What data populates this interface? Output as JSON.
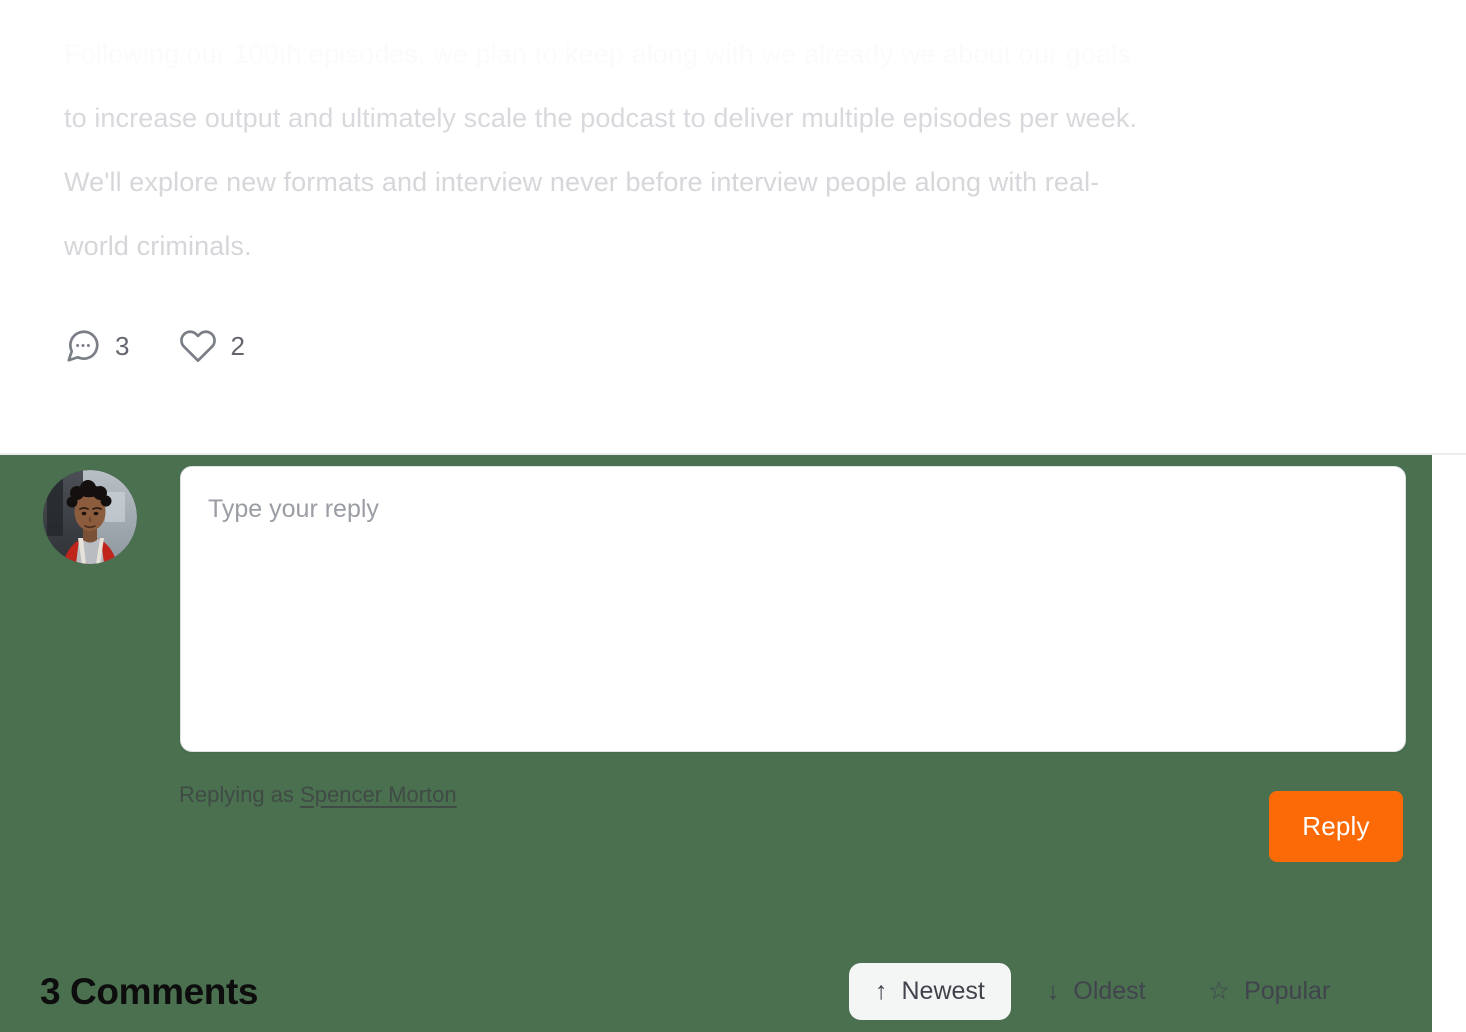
{
  "post": {
    "paragraph_lines": [
      "Following our 100th episodes, we plan to keep along with we already we about our goals",
      "to increase output and ultimately scale the podcast to deliver multiple episodes per week.",
      "We'll explore new formats and interview never before interview people along with real-",
      "world criminals."
    ],
    "engagement": {
      "comments_icon": "comment-bubble-icon",
      "comments_count": "3",
      "likes_icon": "heart-icon",
      "likes_count": "2"
    }
  },
  "reply_composer": {
    "avatar_alt": "Spencer Morton avatar",
    "placeholder": "Type your reply",
    "value": "",
    "replying_as_prefix": "Replying as ",
    "replying_as_user": "Spencer Morton",
    "submit_label": "Reply",
    "submit_color": "#fb6a07",
    "panel_color": "#4a7050"
  },
  "comments_section": {
    "title": "3 Comments",
    "sort_options": [
      {
        "glyph": "↑",
        "icon_name": "arrow-up-icon",
        "label": "Newest",
        "active": true
      },
      {
        "glyph": "↓",
        "icon_name": "arrow-down-icon",
        "label": "Oldest",
        "active": false
      },
      {
        "glyph": "☆",
        "icon_name": "star-icon",
        "label": "Popular",
        "active": false
      }
    ]
  }
}
